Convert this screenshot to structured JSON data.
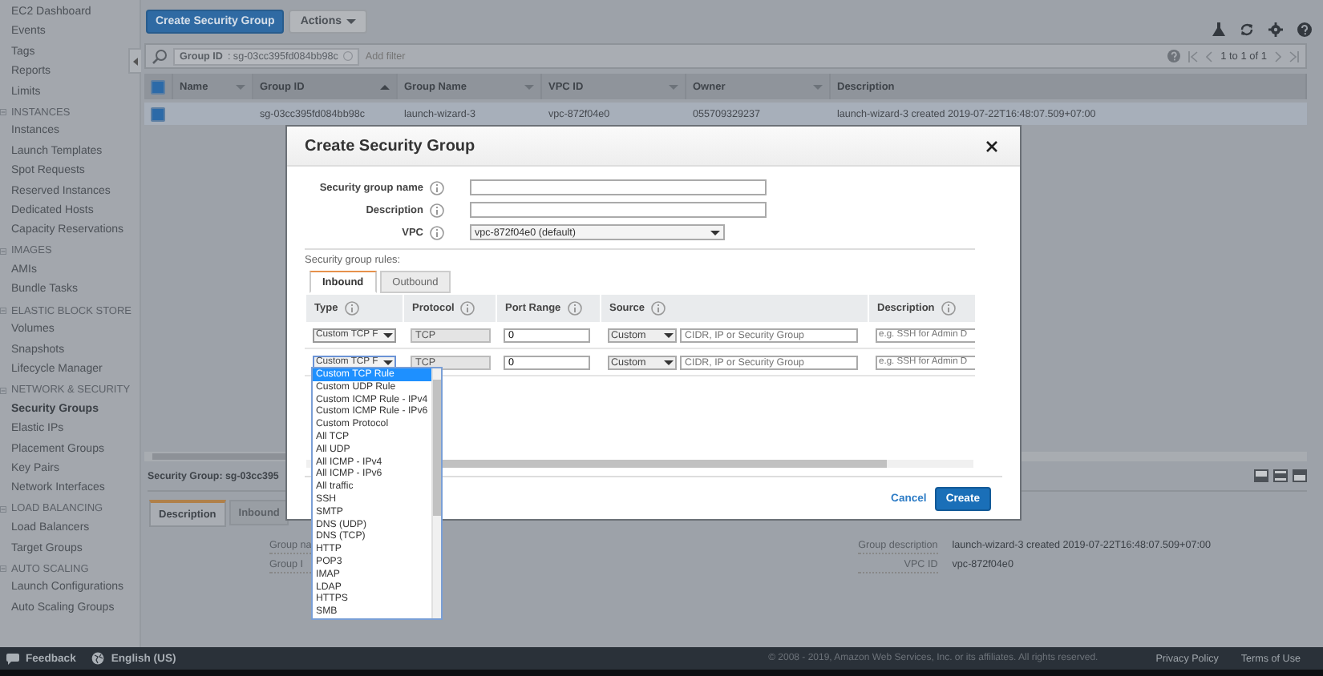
{
  "sidebar": {
    "items": [
      {
        "kind": "link",
        "label": "EC2 Dashboard",
        "selected": false
      },
      {
        "kind": "link",
        "label": "Events",
        "selected": false
      },
      {
        "kind": "link",
        "label": "Tags",
        "selected": false
      },
      {
        "kind": "link",
        "label": "Reports",
        "selected": false
      },
      {
        "kind": "link",
        "label": "Limits",
        "selected": false
      },
      {
        "kind": "section",
        "label": "INSTANCES",
        "expanded": true
      },
      {
        "kind": "link",
        "label": "Instances",
        "selected": false
      },
      {
        "kind": "link",
        "label": "Launch Templates",
        "selected": false
      },
      {
        "kind": "link",
        "label": "Spot Requests",
        "selected": false
      },
      {
        "kind": "link",
        "label": "Reserved Instances",
        "selected": false
      },
      {
        "kind": "link",
        "label": "Dedicated Hosts",
        "selected": false
      },
      {
        "kind": "link",
        "label": "Capacity Reservations",
        "selected": false
      },
      {
        "kind": "section",
        "label": "IMAGES",
        "expanded": true
      },
      {
        "kind": "link",
        "label": "AMIs",
        "selected": false
      },
      {
        "kind": "link",
        "label": "Bundle Tasks",
        "selected": false
      },
      {
        "kind": "section",
        "label": "ELASTIC BLOCK STORE",
        "expanded": true
      },
      {
        "kind": "link",
        "label": "Volumes",
        "selected": false
      },
      {
        "kind": "link",
        "label": "Snapshots",
        "selected": false
      },
      {
        "kind": "link",
        "label": "Lifecycle Manager",
        "selected": false
      },
      {
        "kind": "section",
        "label": "NETWORK & SECURITY",
        "expanded": true
      },
      {
        "kind": "link",
        "label": "Security Groups",
        "selected": true
      },
      {
        "kind": "link",
        "label": "Elastic IPs",
        "selected": false
      },
      {
        "kind": "link",
        "label": "Placement Groups",
        "selected": false
      },
      {
        "kind": "link",
        "label": "Key Pairs",
        "selected": false
      },
      {
        "kind": "link",
        "label": "Network Interfaces",
        "selected": false
      },
      {
        "kind": "section",
        "label": "LOAD BALANCING",
        "expanded": true
      },
      {
        "kind": "link",
        "label": "Load Balancers",
        "selected": false
      },
      {
        "kind": "link",
        "label": "Target Groups",
        "selected": false
      },
      {
        "kind": "section",
        "label": "AUTO SCALING",
        "expanded": true
      },
      {
        "kind": "link",
        "label": "Launch Configurations",
        "selected": false
      },
      {
        "kind": "link",
        "label": "Auto Scaling Groups",
        "selected": false
      }
    ]
  },
  "toolbar": {
    "create_button": "Create Security Group",
    "actions_button": "Actions"
  },
  "filter": {
    "tag": "**Group ID** : sg-03cc395fd084bb98c",
    "placeholder": "Add filter",
    "pagination": "1 to 1 of 1"
  },
  "table": {
    "all_checked": true,
    "columns": [
      {
        "label": "Name",
        "sortable": true,
        "sorted": false
      },
      {
        "label": "Group ID",
        "sortable": true,
        "sorted": true
      },
      {
        "label": "Group Name",
        "sortable": true,
        "sorted": false
      },
      {
        "label": "VPC ID",
        "sortable": true,
        "sorted": false
      },
      {
        "label": "Owner",
        "sortable": true,
        "sorted": false
      },
      {
        "label": "Description",
        "sortable": false,
        "sorted": false
      }
    ],
    "rows": [
      {
        "checked": true,
        "selected": true,
        "group_id": "sg-03cc395fd084bb98c",
        "group_name": "launch-wizard-3",
        "vpc_id": "vpc-872f04e0",
        "owner": "055709329237",
        "description": "launch-wizard-3 created 2019-07-22T16:48:07.509+07:00"
      }
    ]
  },
  "details": {
    "title": "Security Group: sg-03cc395",
    "tabs": [
      {
        "label": "Description",
        "selected": true
      },
      {
        "label": "Inbound",
        "selected": false
      }
    ],
    "left_labels": [
      "Group na",
      "Group I"
    ],
    "fields": [
      {
        "label": "Group description",
        "value": "launch-wizard-3 created 2019-07-22T16:48:07.509+07:00"
      },
      {
        "label": "VPC ID",
        "value": "vpc-872f04e0"
      }
    ]
  },
  "modal": {
    "title": "Create Security Group",
    "fields": [
      {
        "kind": "text",
        "label": "Security group name"
      },
      {
        "kind": "text",
        "label": "Description"
      },
      {
        "kind": "select",
        "label": "VPC",
        "value": "vpc-872f04e0 (default)"
      }
    ],
    "rules_label": "Security group rules:",
    "rule_tabs": [
      {
        "label": "Inbound",
        "selected": true
      },
      {
        "label": "Outbound",
        "selected": false
      }
    ],
    "rule_columns": [
      "Type",
      "Protocol",
      "Port Range",
      "Source",
      "Description"
    ],
    "rules": [
      {
        "type": "Custom TCP F",
        "protocol": "TCP",
        "port_range": "0",
        "source": "Custom",
        "cidr_placeholder": "CIDR, IP or Security Group",
        "description_placeholder": "e.g. SSH for Admin D",
        "open": false
      },
      {
        "type": "Custom TCP F",
        "protocol": "TCP",
        "port_range": "0",
        "source": "Custom",
        "cidr_placeholder": "CIDR, IP or Security Group",
        "description_placeholder": "e.g. SSH for Admin D",
        "open": true
      }
    ],
    "type_options": [
      {
        "label": "Custom TCP Rule",
        "selected": true
      },
      {
        "label": "Custom UDP Rule",
        "selected": false
      },
      {
        "label": "Custom ICMP Rule - IPv4",
        "selected": false
      },
      {
        "label": "Custom ICMP Rule - IPv6",
        "selected": false
      },
      {
        "label": "Custom Protocol",
        "selected": false
      },
      {
        "label": "All TCP",
        "selected": false
      },
      {
        "label": "All UDP",
        "selected": false
      },
      {
        "label": "All ICMP - IPv4",
        "selected": false
      },
      {
        "label": "All ICMP - IPv6",
        "selected": false
      },
      {
        "label": "All traffic",
        "selected": false
      },
      {
        "label": "SSH",
        "selected": false
      },
      {
        "label": "SMTP",
        "selected": false
      },
      {
        "label": "DNS (UDP)",
        "selected": false
      },
      {
        "label": "DNS (TCP)",
        "selected": false
      },
      {
        "label": "HTTP",
        "selected": false
      },
      {
        "label": "POP3",
        "selected": false
      },
      {
        "label": "IMAP",
        "selected": false
      },
      {
        "label": "LDAP",
        "selected": false
      },
      {
        "label": "HTTPS",
        "selected": false
      },
      {
        "label": "SMB",
        "selected": false
      }
    ],
    "cancel_button": "Cancel",
    "create_button": "Create"
  },
  "footer": {
    "feedback": "Feedback",
    "language": "English (US)",
    "copyright": "© 2008 - 2019, Amazon Web Services, Inc. or its affiliates. All rights reserved.",
    "links": [
      "Privacy Policy",
      "Terms of Use"
    ]
  }
}
